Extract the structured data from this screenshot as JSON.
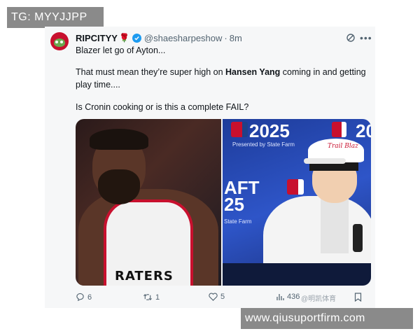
{
  "overlays": {
    "top_left": "TG: MYYJJPP",
    "bottom_right": "www.qiusuportfirm.com"
  },
  "tweet": {
    "display_name": "RIPCITYY",
    "name_emoji": "🌹",
    "handle": "@shaesharpeshow",
    "separator": "·",
    "time": "8m",
    "line1": "Blazer let go of Ayton...",
    "line2_pre": "That must mean they’re super high on ",
    "line2_bold": "Hansen Yang",
    "line2_post": " coming in and getting play time....",
    "line3": "Is Cronin cooking or is this a complete FAIL?",
    "media": {
      "left_jersey_text": "RATERS",
      "right_top_text": "2025",
      "right_top_sub": "Presented by State Farm",
      "right_side_text": "AFT\n25",
      "right_side_sub": "State Farm",
      "right_corner_text": "20",
      "cap_text": "Trail Blaz"
    },
    "actions": {
      "replies": "6",
      "reposts": "1",
      "likes": "5",
      "views": "436"
    },
    "watermark": "@明凯体育"
  },
  "colors": {
    "verified": "#1d9bf0",
    "text": "#0f1419",
    "muted": "#536471",
    "blazers_red": "#c8102e",
    "overlay_bg": "#8a8a8a"
  }
}
